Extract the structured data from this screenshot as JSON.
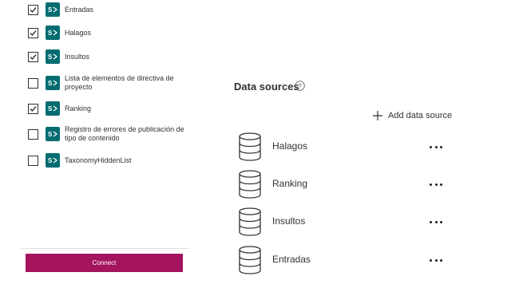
{
  "lists": {
    "items": [
      {
        "label": "Entradas",
        "checked": true
      },
      {
        "label": "Halagos",
        "checked": true
      },
      {
        "label": "Insultos",
        "checked": true
      },
      {
        "label": "Lista de elementos de directiva de proyecto",
        "checked": false
      },
      {
        "label": "Ranking",
        "checked": true
      },
      {
        "label": "Registro de errores de publicación de tipo de contenido",
        "checked": false
      },
      {
        "label": "TaxonomyHiddenList",
        "checked": false
      }
    ],
    "connect_label": "Connect"
  },
  "data_sources": {
    "title": "Data sources",
    "add_label": "Add data source",
    "items": [
      {
        "name": "Halagos"
      },
      {
        "name": "Ranking"
      },
      {
        "name": "Insultos"
      },
      {
        "name": "Entradas"
      }
    ]
  },
  "colors": {
    "accent": "#a4145f",
    "sharepoint_icon": "#036c70",
    "text": "#323130"
  }
}
